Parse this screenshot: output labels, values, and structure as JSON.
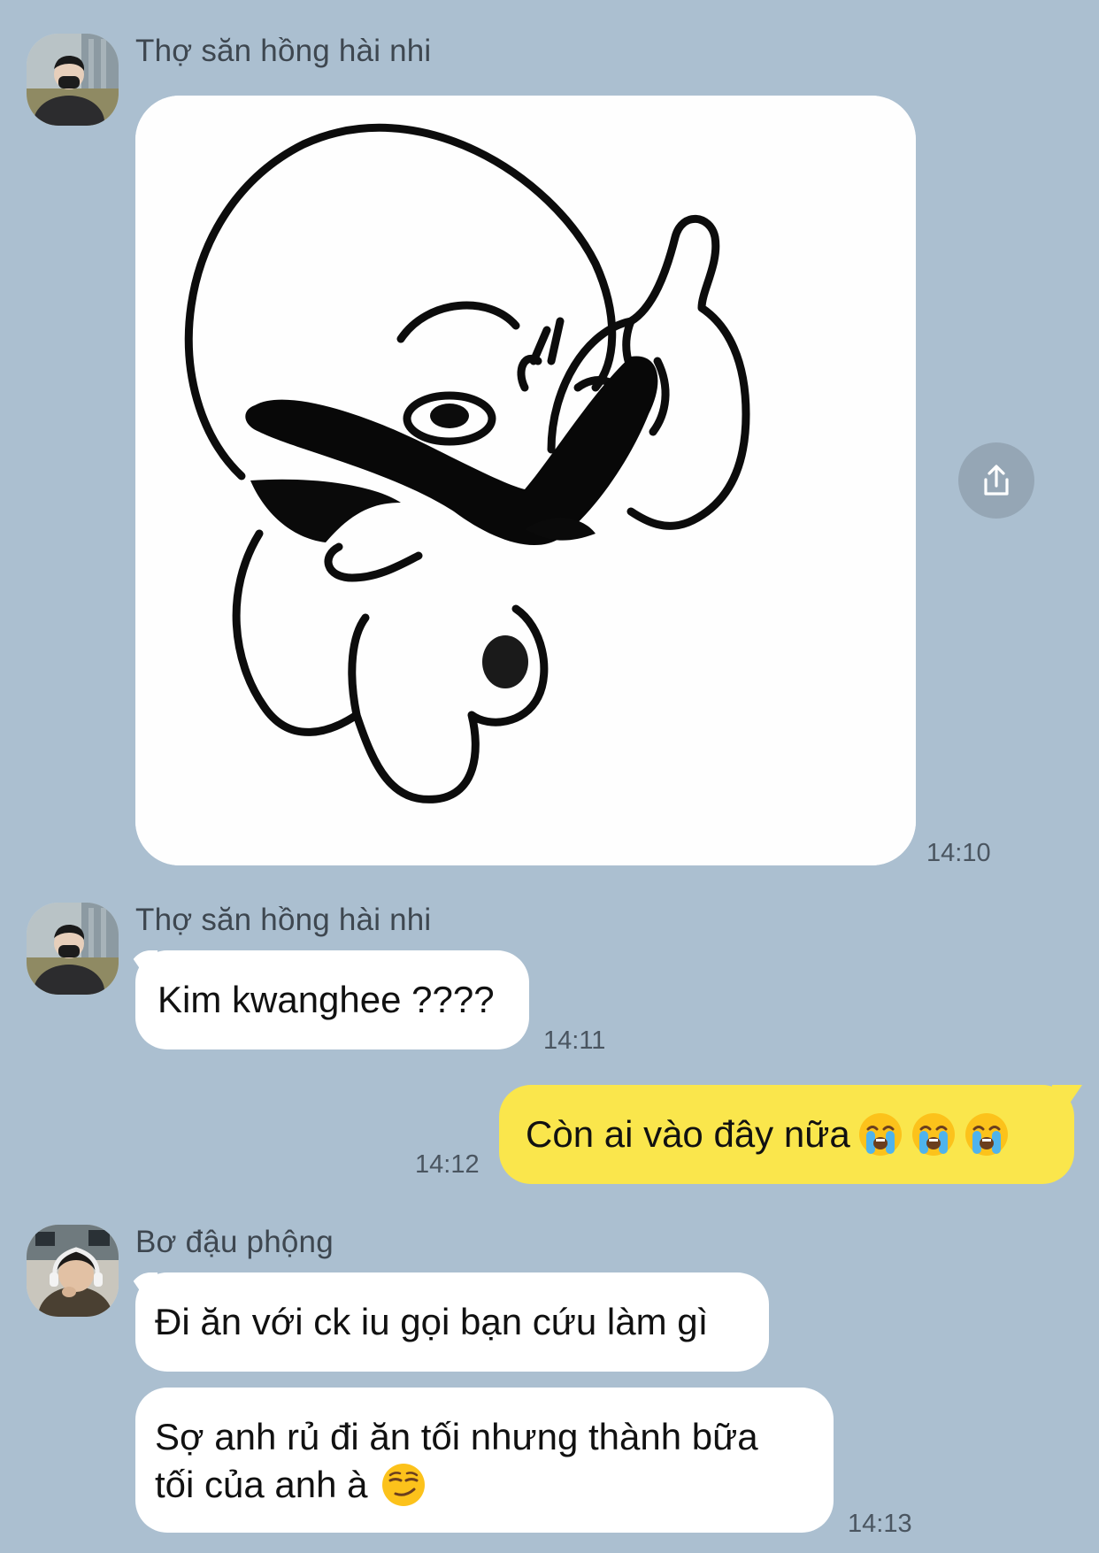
{
  "messages": [
    {
      "sender": "Thợ săn hồng hài nhi",
      "time": "14:10"
    },
    {
      "sender": "Thợ săn hồng hài nhi",
      "text": "Kim kwanghee ????",
      "time": "14:11"
    },
    {
      "text": "Còn ai vào đây nữa",
      "time": "14:12"
    },
    {
      "sender": "Bơ đậu phộng",
      "bubble1": "Đi ăn với ck iu gọi bạn cứu làm gì",
      "bubble2_line1": "Sợ anh rủ đi ăn tối nhưng thành bữa",
      "bubble2_line2": "tối của anh à",
      "time": "14:13"
    }
  ],
  "icons": {
    "share": "share-icon",
    "crying": "loudly-crying-face-emoji",
    "smirk": "smirking-face-emoji"
  },
  "colors": {
    "background": "#abbfd0",
    "incoming_bubble": "#ffffff",
    "outgoing_bubble": "#fae64c"
  }
}
